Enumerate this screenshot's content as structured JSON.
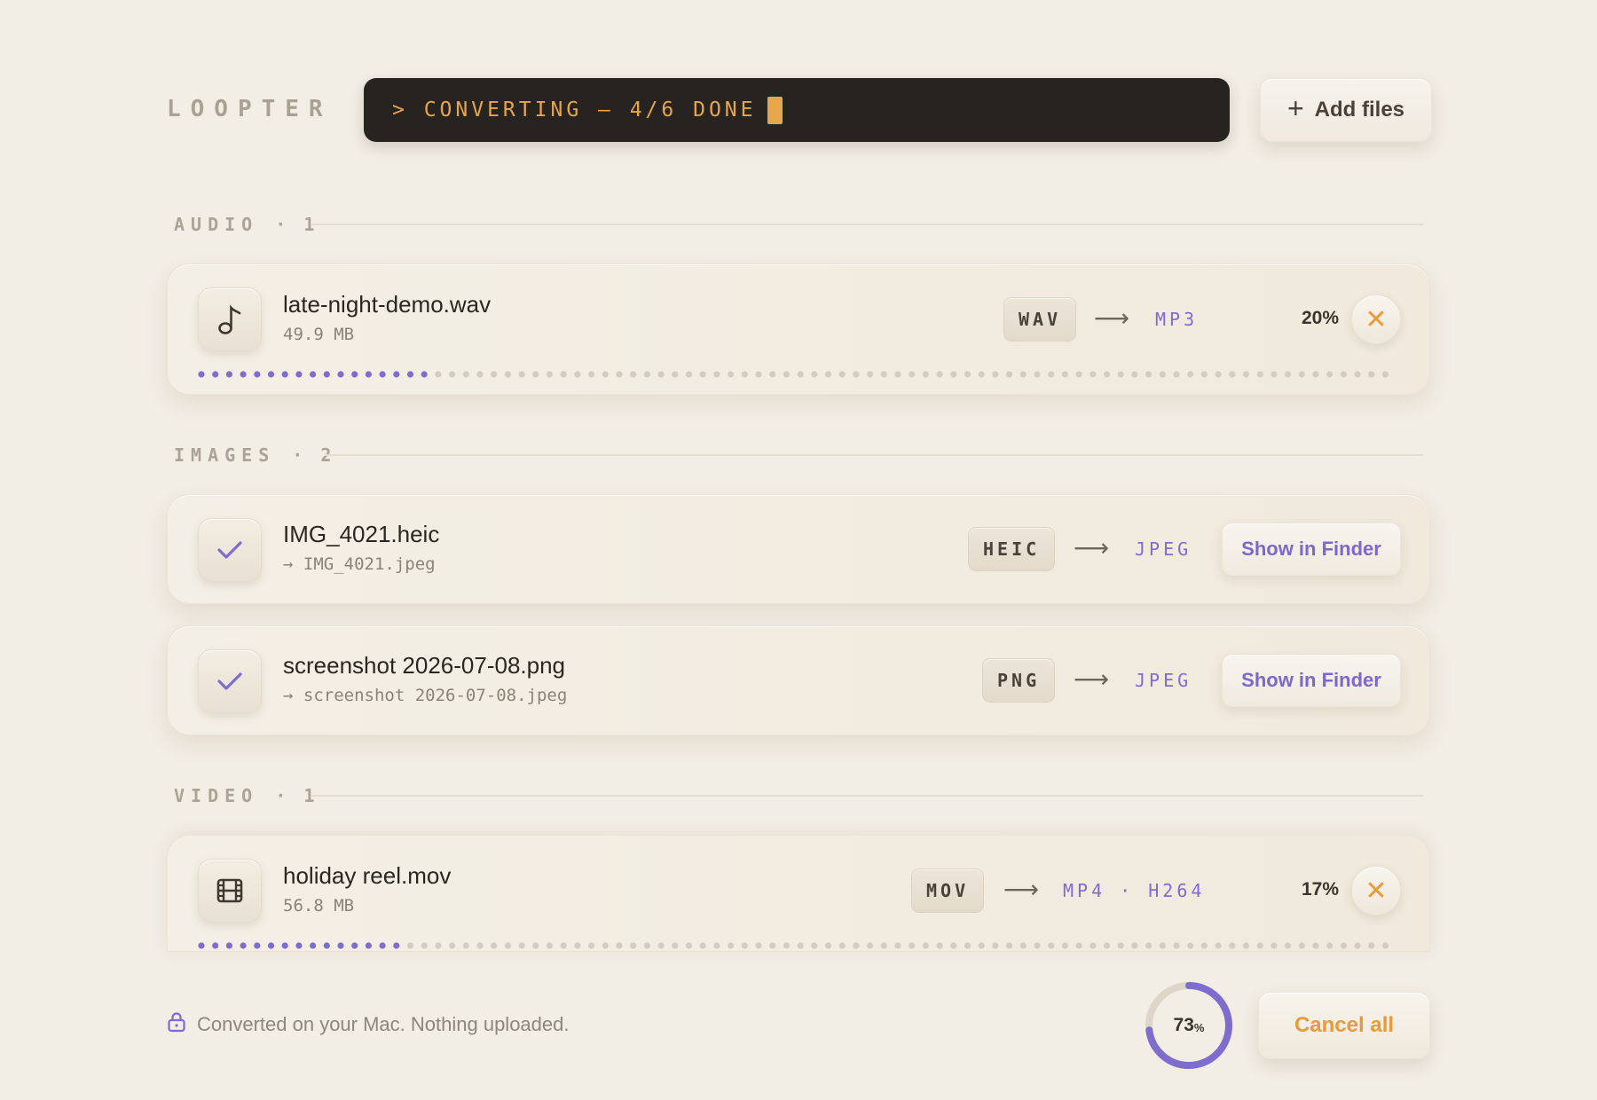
{
  "app": {
    "logo": "LOOPTER"
  },
  "status": {
    "text": "> CONVERTING — 4/6 DONE"
  },
  "toolbar": {
    "add_files_label": "Add files"
  },
  "sections": {
    "audio": {
      "label": "AUDIO",
      "count": "· 1"
    },
    "images": {
      "label": "IMAGES",
      "count": "· 2"
    },
    "video": {
      "label": "VIDEO",
      "count": "· 1"
    }
  },
  "files": {
    "wav": {
      "name": "late-night-demo.wav",
      "size": "49.9 MB",
      "from": "WAV",
      "arrow": "⟶",
      "to": "MP3",
      "percent_label": "20%",
      "progress": 0.2,
      "state": "converting"
    },
    "heic": {
      "name": "IMG_4021.heic",
      "output": "→ IMG_4021.jpeg",
      "from": "HEIC",
      "arrow": "⟶",
      "to": "JPEG",
      "action_label": "Show in Finder",
      "state": "done"
    },
    "png": {
      "name": "screenshot 2026-07-08.png",
      "output": "→ screenshot 2026-07-08.jpeg",
      "from": "PNG",
      "arrow": "⟶",
      "to": "JPEG",
      "action_label": "Show in Finder",
      "state": "done"
    },
    "mov": {
      "name": "holiday reel.mov",
      "size": "56.8 MB",
      "from": "MOV",
      "arrow": "⟶",
      "to": "MP4 · H264",
      "percent_label": "17%",
      "progress": 0.17,
      "state": "converting"
    }
  },
  "footer": {
    "privacy_note": "Converted on your Mac. Nothing uploaded.",
    "overall_value": "73",
    "overall_unit": "%",
    "overall_progress": 0.73,
    "cancel_all_label": "Cancel all"
  },
  "icons": {
    "wav": "music-note-icon",
    "heic": "check-icon",
    "png": "check-icon",
    "mov": "film-icon",
    "cancel": "close-icon",
    "privacy": "lock-icon",
    "add": "plus-icon"
  },
  "colors": {
    "background": "#f2ede5",
    "terminal_bg": "#262320",
    "terminal_text": "#e6a64a",
    "accent_purple": "#7e6ccf",
    "accent_orange": "#e89a3a",
    "dot_inactive": "#d3ccc0"
  }
}
